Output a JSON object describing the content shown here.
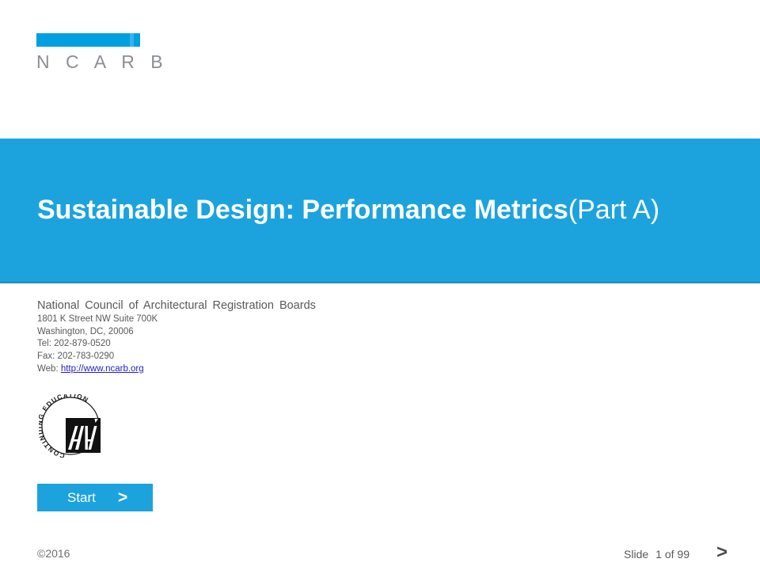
{
  "logo": {
    "wordmark": "N C A R B",
    "bar_color": "#00a0e0",
    "text_color": "#8a8f94"
  },
  "title": {
    "main": "Sustainable Design: Performance Metrics",
    "suffix": " (Part A)",
    "band_color": "#1ca3dd",
    "text_color": "#ffffff"
  },
  "contact": {
    "organization": "National Council of Architectural Registration Boards",
    "address1": "1801 K Street NW Suite 700K",
    "address2": "Washington, DC, 20006",
    "tel": "Tel: 202-879-0520",
    "fax": "Fax: 202-783-0290",
    "web_label": "Web: ",
    "web_url": "http://www.ncarb.org",
    "link_color": "#2222cc"
  },
  "seal": {
    "circular_text": "CONTINUING EDUCATION",
    "mark": "AIA"
  },
  "start_button": {
    "label": "Start",
    "chevron": ">",
    "color": "#1ca3dd"
  },
  "footer": {
    "copyright": "©2016",
    "slide_label": "Slide",
    "slide_position": "1 of 99",
    "next_chevron": ">"
  }
}
